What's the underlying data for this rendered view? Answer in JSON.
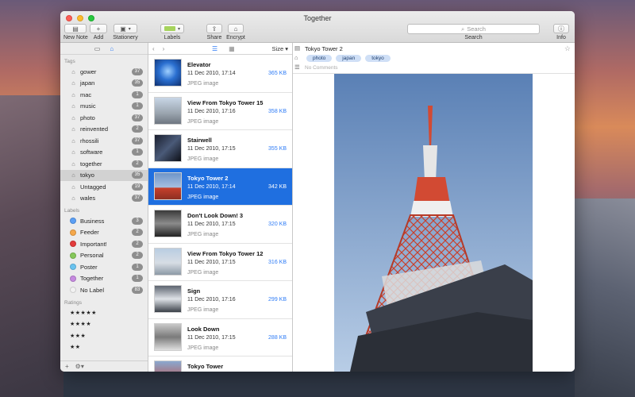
{
  "window": {
    "title": "Together"
  },
  "toolbar": {
    "new_note": "New Note",
    "add": "Add",
    "stationery": "Stationery",
    "labels": "Labels",
    "share": "Share",
    "encrypt": "Encrypt",
    "search_placeholder": "Search",
    "search_label": "Search",
    "info": "Info"
  },
  "sidebar": {
    "tags_header": "Tags",
    "tags": [
      {
        "name": "gower",
        "count": "37"
      },
      {
        "name": "japan",
        "count": "35"
      },
      {
        "name": "mac",
        "count": "1"
      },
      {
        "name": "music",
        "count": "1"
      },
      {
        "name": "photo",
        "count": "37"
      },
      {
        "name": "reinvented",
        "count": "2"
      },
      {
        "name": "rhossili",
        "count": "37"
      },
      {
        "name": "software",
        "count": "1"
      },
      {
        "name": "together",
        "count": "2"
      },
      {
        "name": "tokyo",
        "count": "35",
        "selected": true
      },
      {
        "name": "Untagged",
        "count": "19"
      },
      {
        "name": "wales",
        "count": "37"
      }
    ],
    "labels_header": "Labels",
    "labels": [
      {
        "name": "Business",
        "count": "3",
        "color": "#5b9ff5"
      },
      {
        "name": "Feeder",
        "count": "2",
        "color": "#f5a84a"
      },
      {
        "name": "Important!",
        "count": "2",
        "color": "#e33b3b"
      },
      {
        "name": "Personal",
        "count": "2",
        "color": "#86c85a"
      },
      {
        "name": "Poster",
        "count": "1",
        "color": "#69c3f0"
      },
      {
        "name": "Together",
        "count": "1",
        "color": "#c68ae0"
      },
      {
        "name": "No Label",
        "count": "83",
        "color": "#f2f2f2"
      }
    ],
    "ratings_header": "Ratings",
    "ratings": [
      "★★★★★",
      "★★★★",
      "★★★",
      "★★"
    ]
  },
  "notelist": {
    "sort_label": "Size",
    "notes": [
      {
        "title": "Elevator",
        "date": "11 Dec 2010, 17:14",
        "size": "365 KB",
        "type": "JPEG image"
      },
      {
        "title": "View From Tokyo Tower 15",
        "date": "11 Dec 2010, 17:16",
        "size": "358 KB",
        "type": "JPEG image"
      },
      {
        "title": "Stairwell",
        "date": "11 Dec 2010, 17:15",
        "size": "355 KB",
        "type": "JPEG image"
      },
      {
        "title": "Tokyo Tower 2",
        "date": "11 Dec 2010, 17:14",
        "size": "342 KB",
        "type": "JPEG image",
        "selected": true
      },
      {
        "title": "Don't Look Down! 3",
        "date": "11 Dec 2010, 17:15",
        "size": "320 KB",
        "type": "JPEG image"
      },
      {
        "title": "View From Tokyo Tower 12",
        "date": "11 Dec 2010, 17:15",
        "size": "316 KB",
        "type": "JPEG image"
      },
      {
        "title": "Sign",
        "date": "11 Dec 2010, 17:16",
        "size": "299 KB",
        "type": "JPEG image"
      },
      {
        "title": "Look Down",
        "date": "11 Dec 2010, 17:15",
        "size": "288 KB",
        "type": "JPEG image"
      },
      {
        "title": "Tokyo Tower",
        "date": "",
        "size": "",
        "type": ""
      }
    ]
  },
  "detail": {
    "title": "Tokyo Tower 2",
    "tags": [
      "photo",
      "japan",
      "tokyo"
    ],
    "comment_placeholder": "No Comments"
  }
}
